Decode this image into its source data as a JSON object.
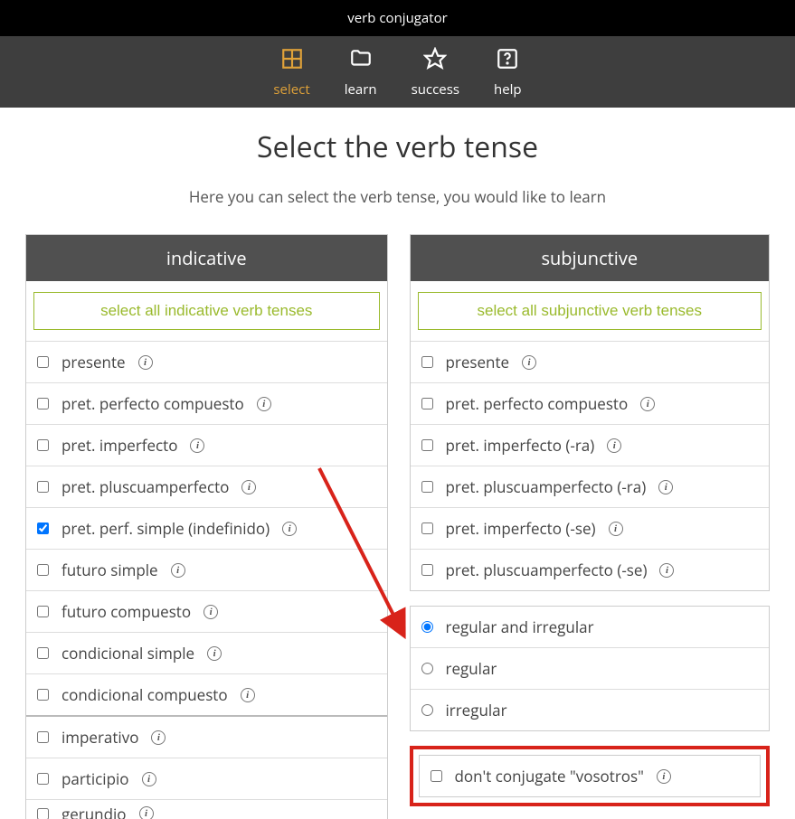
{
  "app_title": "verb conjugator",
  "nav": [
    {
      "label": "select",
      "icon": "grid"
    },
    {
      "label": "learn",
      "icon": "folder"
    },
    {
      "label": "success",
      "icon": "star"
    },
    {
      "label": "help",
      "icon": "help"
    }
  ],
  "nav_active_index": 0,
  "page": {
    "title": "Select the verb tense",
    "subtitle": "Here you can select the verb tense, you would like to learn"
  },
  "indicative": {
    "header": "indicative",
    "select_all": "select all indicative verb tenses",
    "items": [
      {
        "label": "presente",
        "checked": false
      },
      {
        "label": "pret. perfecto compuesto",
        "checked": false
      },
      {
        "label": "pret. imperfecto",
        "checked": false
      },
      {
        "label": "pret. pluscuamperfecto",
        "checked": false
      },
      {
        "label": "pret. perf. simple (indefinido)",
        "checked": true
      },
      {
        "label": "futuro simple",
        "checked": false
      },
      {
        "label": "futuro compuesto",
        "checked": false
      },
      {
        "label": "condicional simple",
        "checked": false
      },
      {
        "label": "condicional compuesto",
        "checked": false
      }
    ],
    "extra_items": [
      {
        "label": "imperativo",
        "checked": false
      },
      {
        "label": "participio",
        "checked": false
      },
      {
        "label": "gerundio",
        "checked": false
      }
    ]
  },
  "subjunctive": {
    "header": "subjunctive",
    "select_all": "select all subjunctive verb tenses",
    "items": [
      {
        "label": "presente",
        "checked": false
      },
      {
        "label": "pret. perfecto compuesto",
        "checked": false
      },
      {
        "label": "pret. imperfecto (-ra)",
        "checked": false
      },
      {
        "label": "pret. pluscuamperfecto (-ra)",
        "checked": false
      },
      {
        "label": "pret. imperfecto (-se)",
        "checked": false
      },
      {
        "label": "pret. pluscuamperfecto (-se)",
        "checked": false
      }
    ]
  },
  "regularity": {
    "options": [
      {
        "label": "regular and irregular",
        "checked": true
      },
      {
        "label": "regular",
        "checked": false
      },
      {
        "label": "irregular",
        "checked": false
      }
    ]
  },
  "vosotros": {
    "label": "don't conjugate \"vosotros\"",
    "checked": false
  },
  "annotation": {
    "arrow_color": "#d8231a"
  }
}
